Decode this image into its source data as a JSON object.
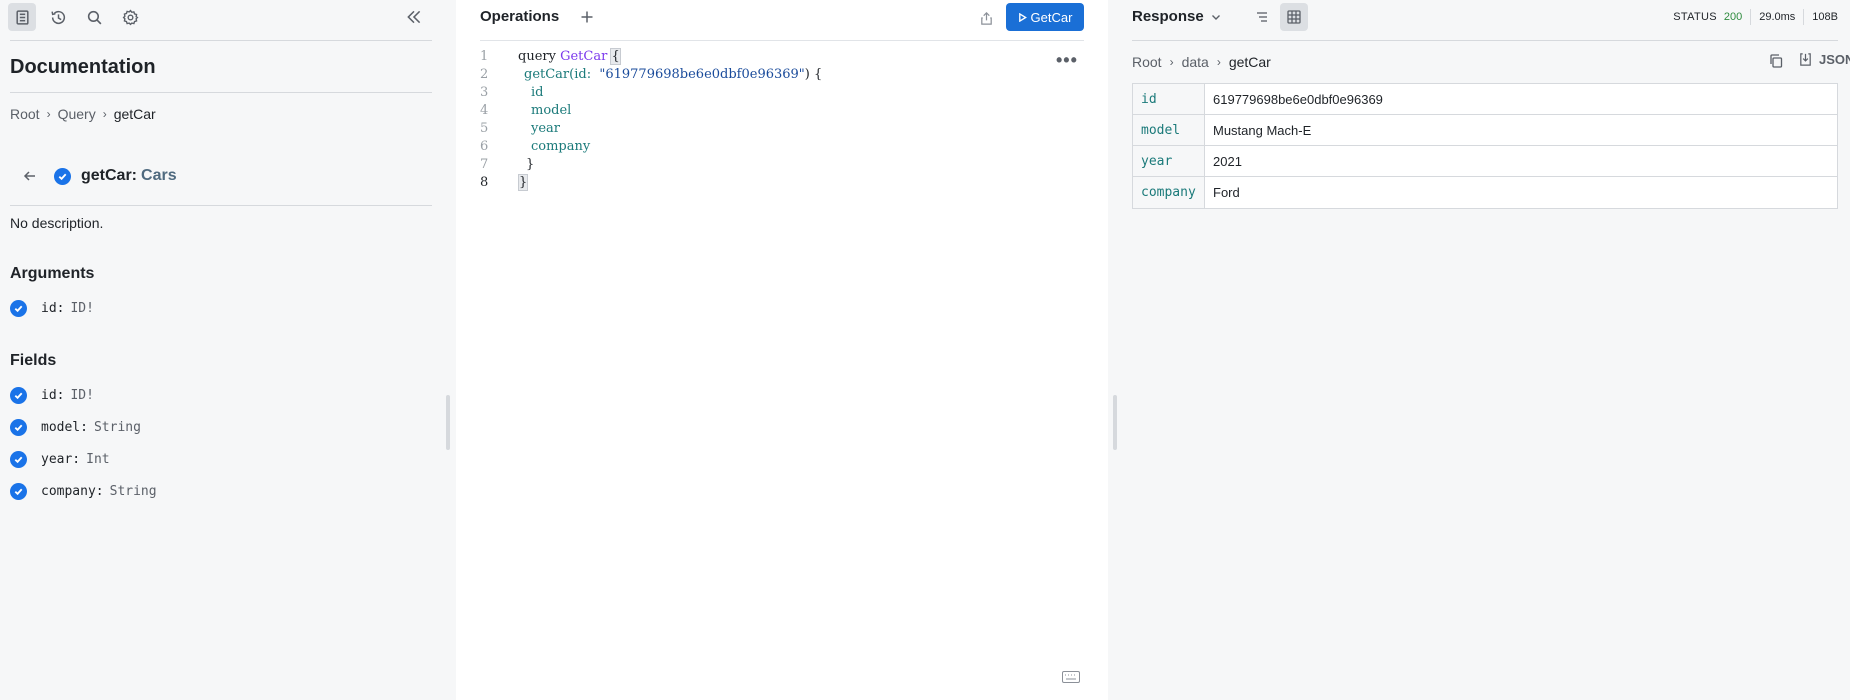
{
  "sidebar": {
    "icons": [
      "docs-icon",
      "history-icon",
      "search-icon",
      "settings-icon"
    ],
    "title": "Documentation",
    "breadcrumbs": [
      "Root",
      "Query",
      "getCar"
    ],
    "field": {
      "name": "getCar:",
      "type": "Cars"
    },
    "description": "No description.",
    "arguments_title": "Arguments",
    "arguments": [
      {
        "name": "id:",
        "type": "ID!"
      }
    ],
    "fields_title": "Fields",
    "fields": [
      {
        "name": "id:",
        "type": "ID!"
      },
      {
        "name": "model:",
        "type": "String"
      },
      {
        "name": "year:",
        "type": "Int"
      },
      {
        "name": "company:",
        "type": "String"
      }
    ]
  },
  "operations": {
    "title": "Operations",
    "run_label": "GetCar",
    "line_numbers": [
      "1",
      "2",
      "3",
      "4",
      "5",
      "6",
      "7",
      "8"
    ],
    "code": {
      "l1_kw": "query",
      "l1_name": "GetCar",
      "l1_brace": "{",
      "l2_fn": "getCar",
      "l2_open": "(id:",
      "l2_str": "\"619779698be6e0dbf0e96369\"",
      "l2_close": ") {",
      "l3": "id",
      "l4": "model",
      "l5": "year",
      "l6": "company",
      "l7": "}",
      "l8": "}"
    }
  },
  "response": {
    "title": "Response",
    "status_label": "STATUS",
    "status_code": "200",
    "time": "29.0ms",
    "size": "108B",
    "breadcrumbs": [
      "Root",
      "data",
      "getCar"
    ],
    "json_label": "JSON",
    "rows": [
      {
        "key": "id",
        "value": "619779698be6e0dbf0e96369"
      },
      {
        "key": "model",
        "value": "Mustang Mach-E"
      },
      {
        "key": "year",
        "value": "2021"
      },
      {
        "key": "company",
        "value": "Ford"
      }
    ]
  }
}
